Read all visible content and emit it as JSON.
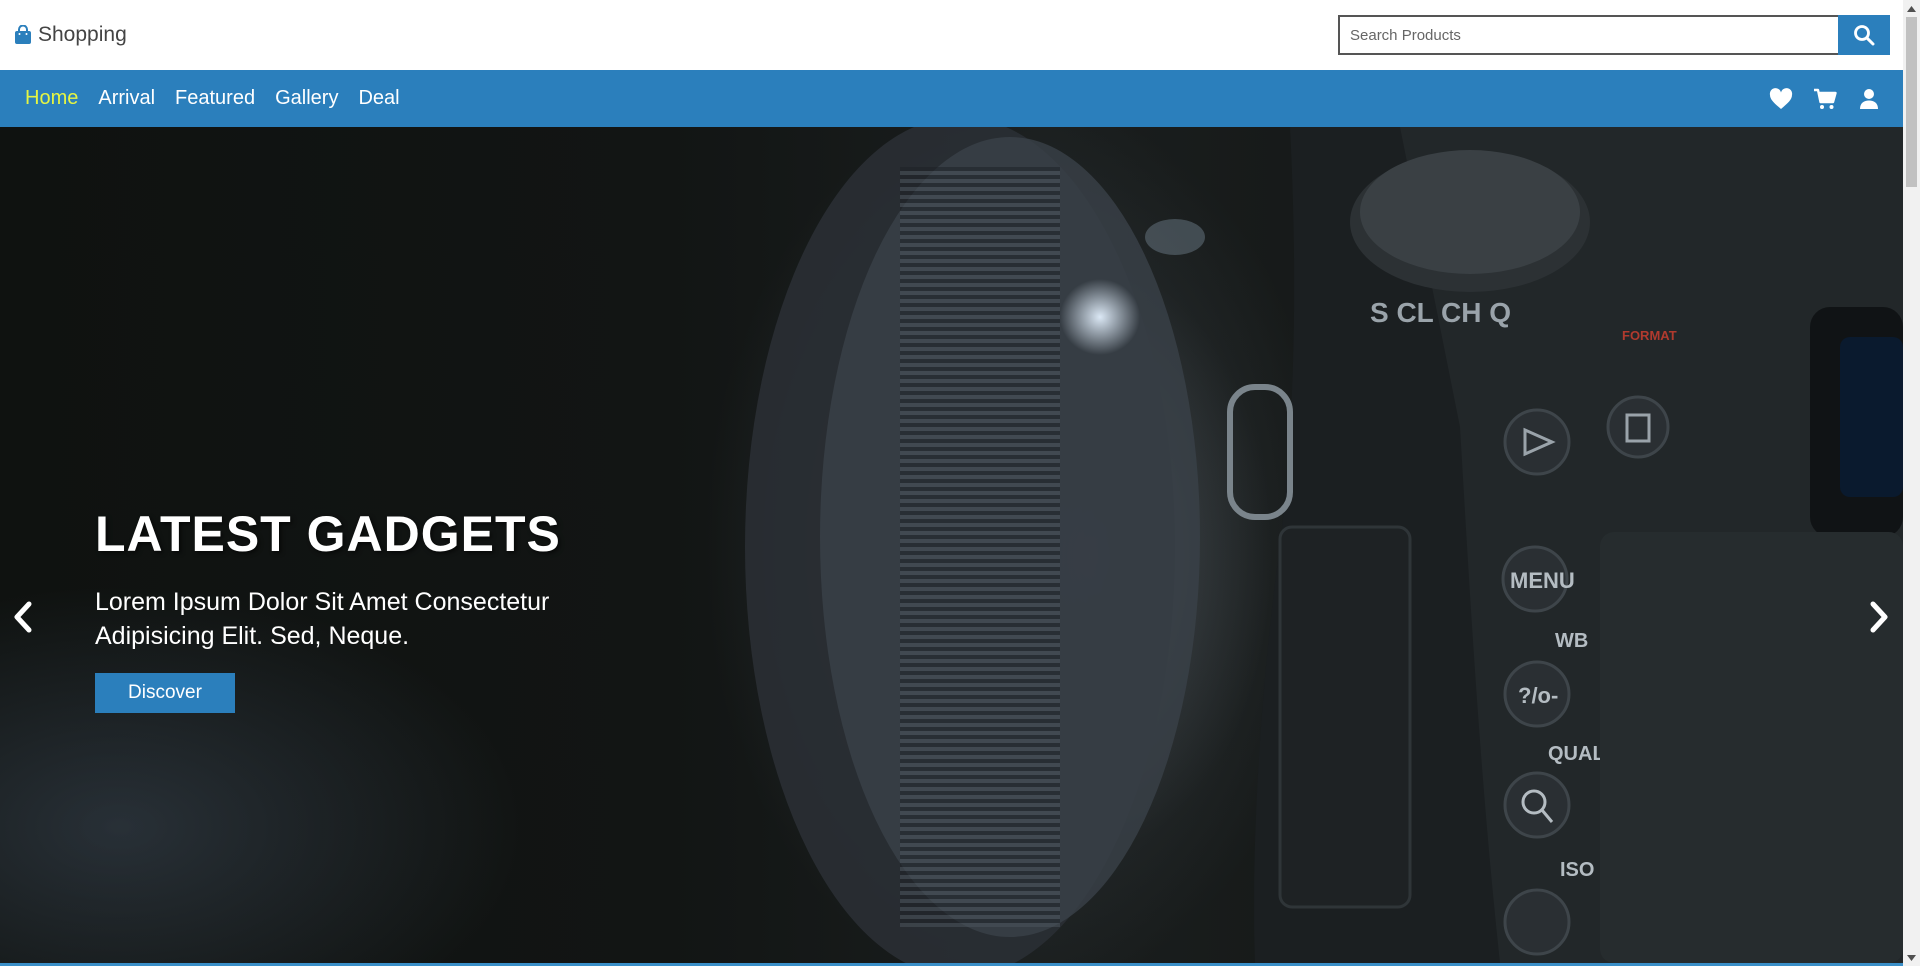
{
  "brand": {
    "name": "Shopping",
    "icon": "shopping-bag-icon"
  },
  "search": {
    "placeholder": "Search Products",
    "value": "",
    "icon": "search-icon"
  },
  "nav": {
    "items": [
      {
        "label": "Home",
        "active": true
      },
      {
        "label": "Arrival",
        "active": false
      },
      {
        "label": "Featured",
        "active": false
      },
      {
        "label": "Gallery",
        "active": false
      },
      {
        "label": "Deal",
        "active": false
      }
    ],
    "icons": [
      "heart-icon",
      "cart-icon",
      "user-icon"
    ]
  },
  "hero": {
    "title": "LATEST GADGETS",
    "subtitle": "Lorem Ipsum Dolor Sit Amet Consectetur Adipisicing Elit. Sed, Neque.",
    "button": "Discover",
    "camera_labels": {
      "menu": "MENU",
      "wb": "WB",
      "qual": "QUAL",
      "iso": "ISO",
      "format": "FORMAT"
    }
  },
  "colors": {
    "accent": "#2b7fbc",
    "active_nav": "#e6f542",
    "hero_text": "#ffffff"
  }
}
